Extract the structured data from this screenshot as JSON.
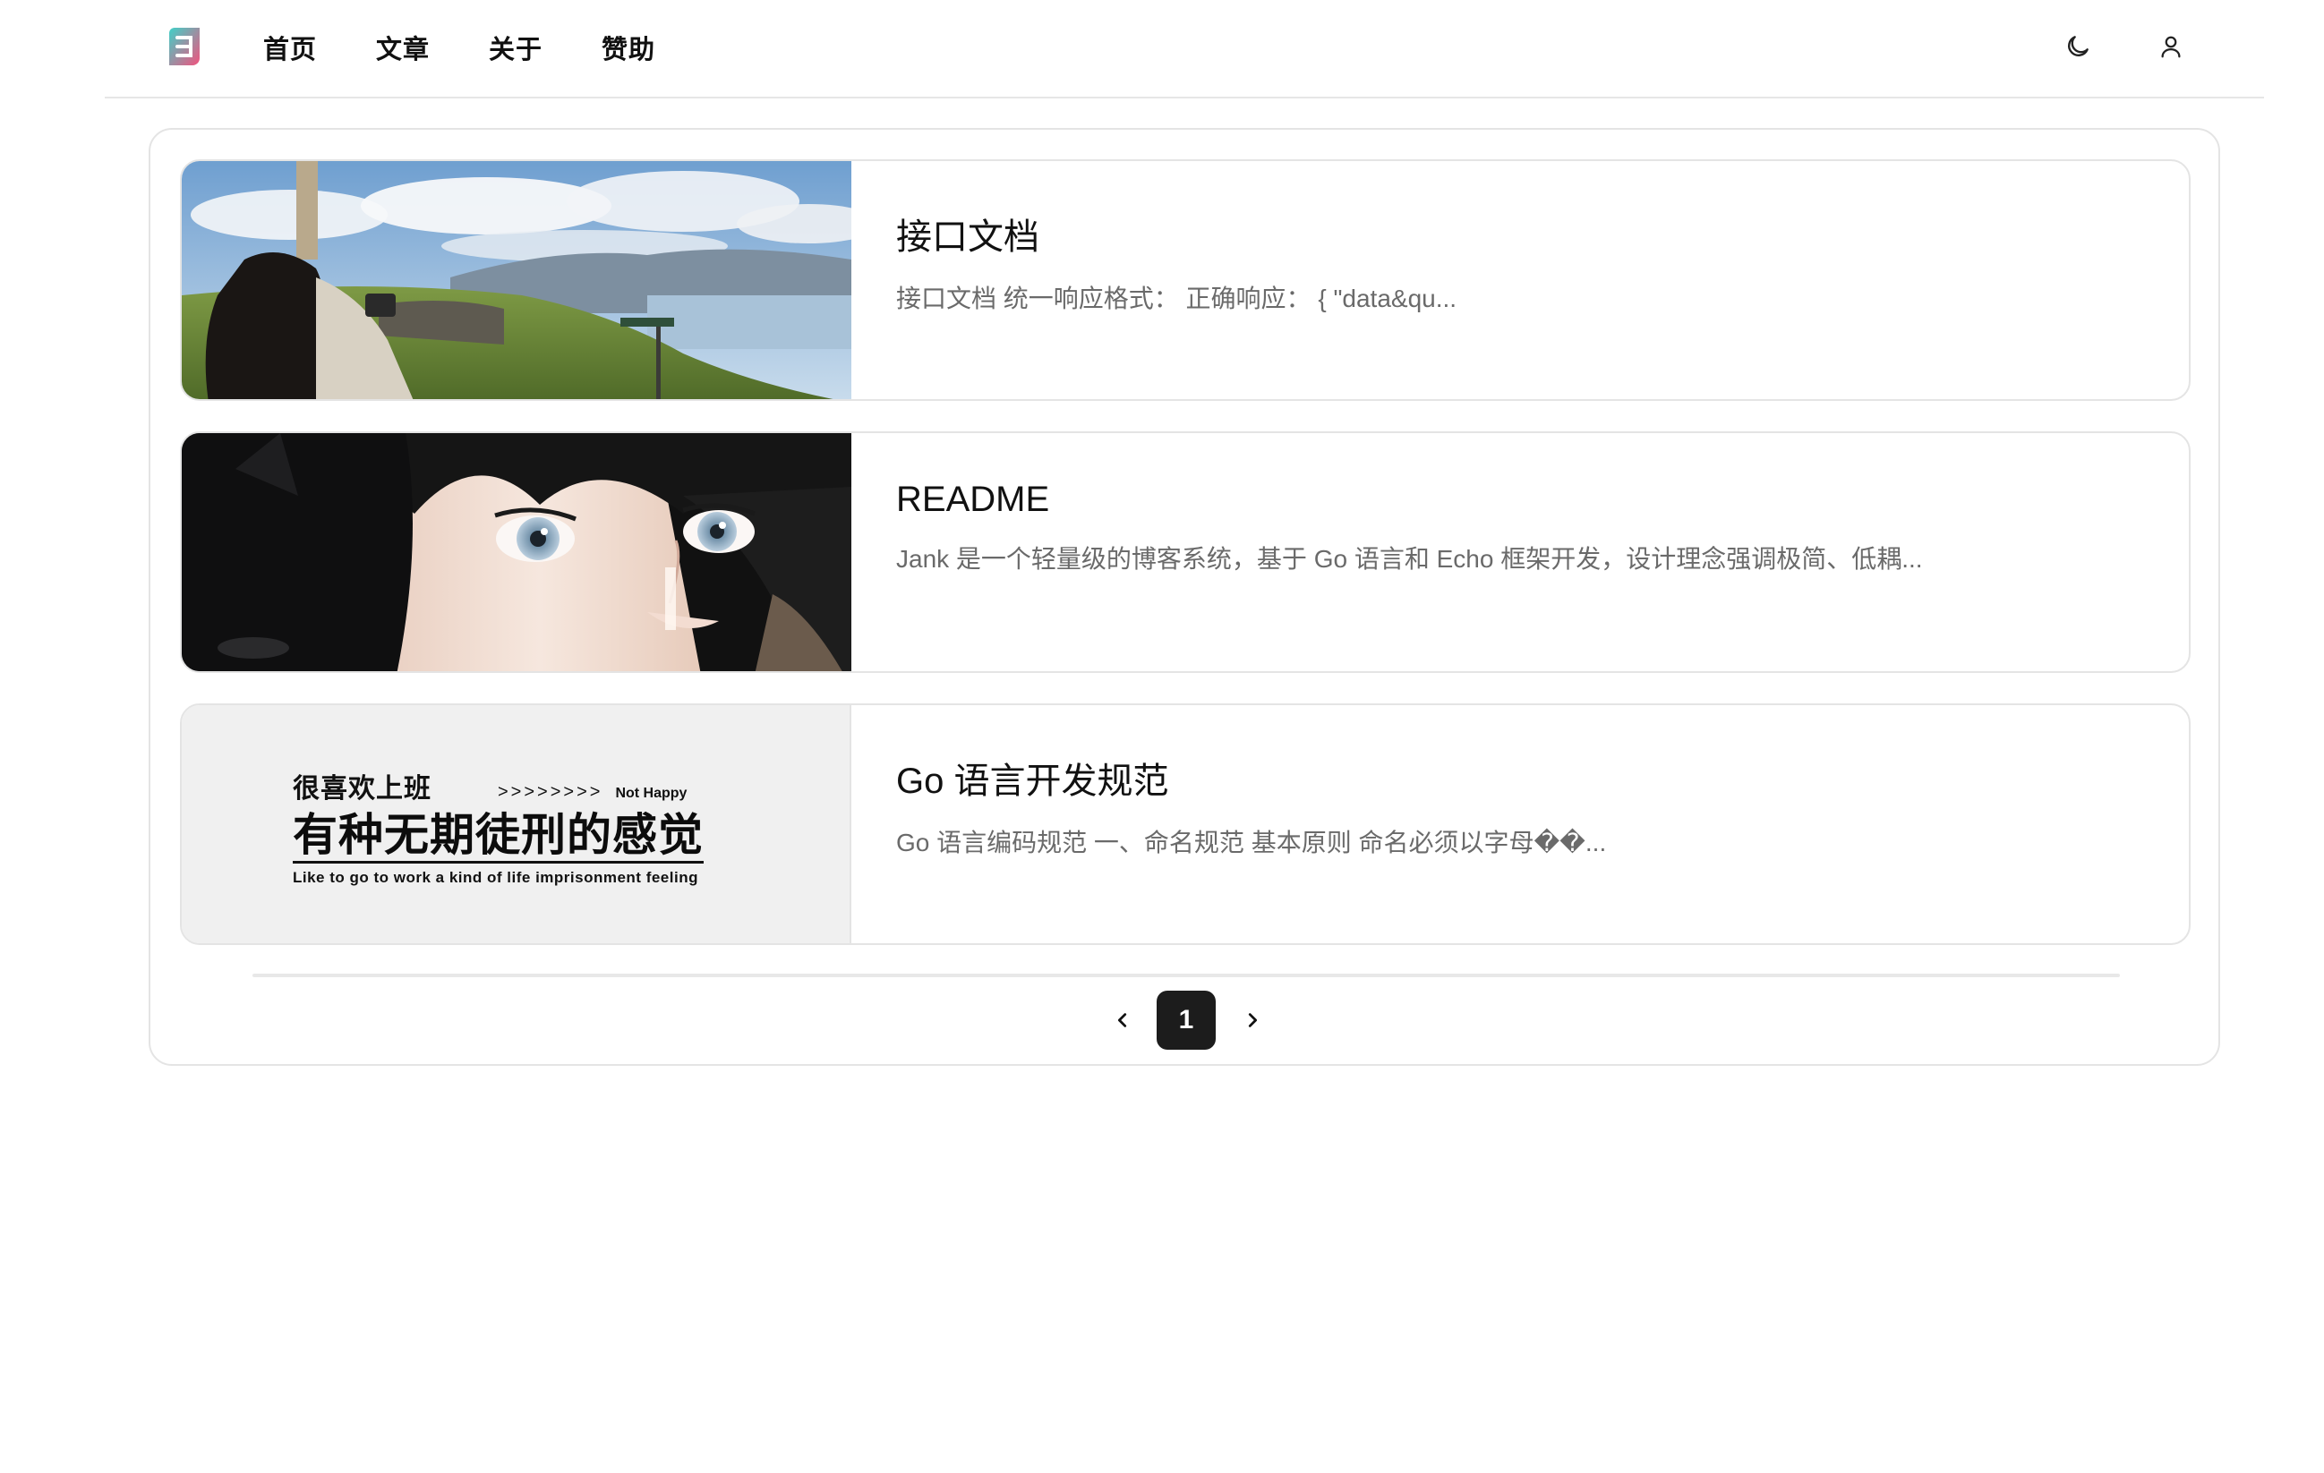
{
  "header": {
    "logo_icon": "blog-logo-icon",
    "nav": [
      {
        "label": "首页"
      },
      {
        "label": "文章"
      },
      {
        "label": "关于"
      },
      {
        "label": "赞助"
      }
    ],
    "theme_icon": "moon-icon",
    "user_icon": "user-icon"
  },
  "posts": [
    {
      "title": "接口文档",
      "excerpt": "接口文档 统一响应格式： 正确响应： { \"data&qu...",
      "thumb": "photographer-on-coastal-cliff-photo"
    },
    {
      "title": "README",
      "excerpt": "Jank 是一个轻量级的博客系统，基于 Go 语言和 Echo 框架开发，设计理念强调极简、低耦...",
      "thumb": "anime-girl-with-black-cat-illustration"
    },
    {
      "title": "Go 语言开发规范",
      "excerpt": "Go 语言编码规范 一、命名规范 基本原则 命名必须以字母��...",
      "thumb": "text-banner-image",
      "banner": {
        "line1": "很喜欢上班",
        "arrows": ">>>>>>>>",
        "tag": "Not Happy",
        "headline": "有种无期徒刑的感觉",
        "subline": "Like to go to work a kind of life imprisonment feeling"
      }
    }
  ],
  "pagination": {
    "prev_icon": "chevron-left-icon",
    "next_icon": "chevron-right-icon",
    "current_page": "1"
  }
}
